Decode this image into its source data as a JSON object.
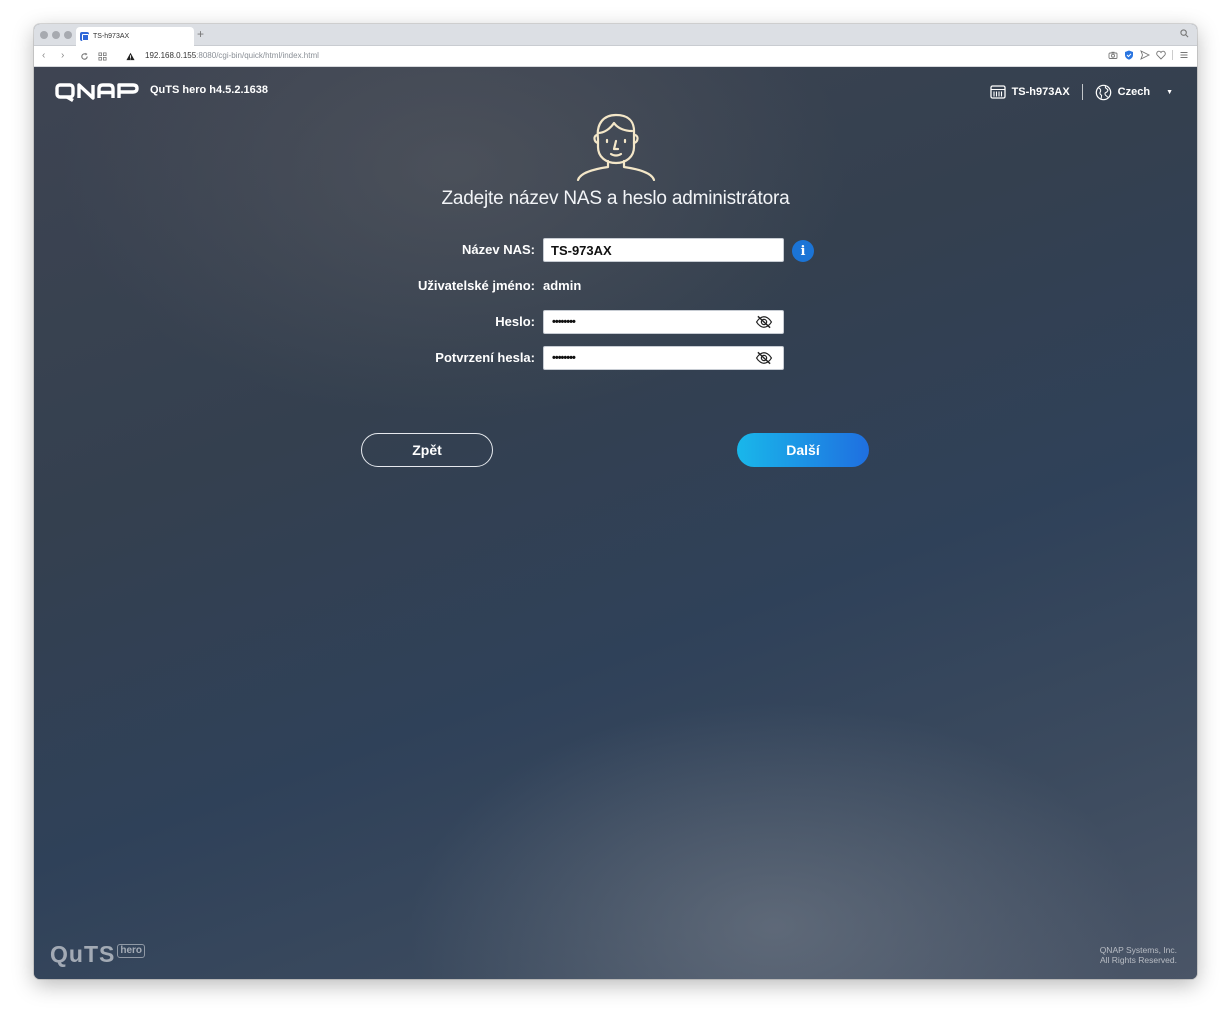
{
  "browser": {
    "tab_title": "TS-h973AX",
    "url_host": "192.168.0.155",
    "url_rest": ":8080/cgi-bin/quick/html/index.html"
  },
  "header": {
    "version": "QuTS hero h4.5.2.1638",
    "device_name": "TS-h973AX",
    "language": "Czech"
  },
  "form": {
    "heading": "Zadejte název NAS a heslo administrátora",
    "nas_name_label": "Název NAS:",
    "nas_name_value": "TS-973AX",
    "username_label": "Uživatelské jméno:",
    "username_value": "admin",
    "password_label": "Heslo:",
    "password_mask": "••••••••",
    "confirm_label": "Potvrzení hesla:",
    "confirm_mask": "••••••••"
  },
  "buttons": {
    "back": "Zpět",
    "next": "Další"
  },
  "footer": {
    "logo_main": "QuTS",
    "logo_sub": "hero",
    "copyright_line1": "QNAP Systems, Inc.",
    "copyright_line2": "All Rights Reserved."
  },
  "colors": {
    "accent_start": "#19b7ea",
    "accent_end": "#1f6fe0",
    "info": "#1b74d6"
  }
}
